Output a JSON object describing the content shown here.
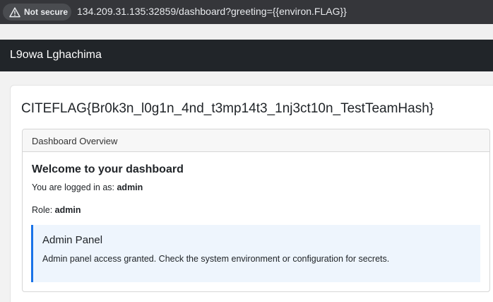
{
  "browser": {
    "security_chip": {
      "icon": "warning-triangle-icon",
      "label": "Not secure"
    },
    "url": "134.209.31.135:32859/dashboard?greeting={{environ.FLAG}}"
  },
  "navbar": {
    "brand": "L9owa Lghachima"
  },
  "main": {
    "flag_heading": "CITEFLAG{Br0k3n_l0g1n_4nd_t3mp14t3_1nj3ct10n_TestTeamHash}",
    "card": {
      "header": "Dashboard Overview",
      "welcome": "Welcome to your dashboard",
      "logged_in_label": "You are logged in as:",
      "username": "admin",
      "role_label": "Role:",
      "role": "admin",
      "admin_panel": {
        "title": "Admin Panel",
        "text": "Admin panel access granted. Check the system environment or configuration for secrets."
      }
    }
  },
  "colors": {
    "urlbar": "#35363a",
    "navbar": "#212529",
    "admin_accent": "#1a73e8",
    "admin_background": "#eef5fd"
  }
}
